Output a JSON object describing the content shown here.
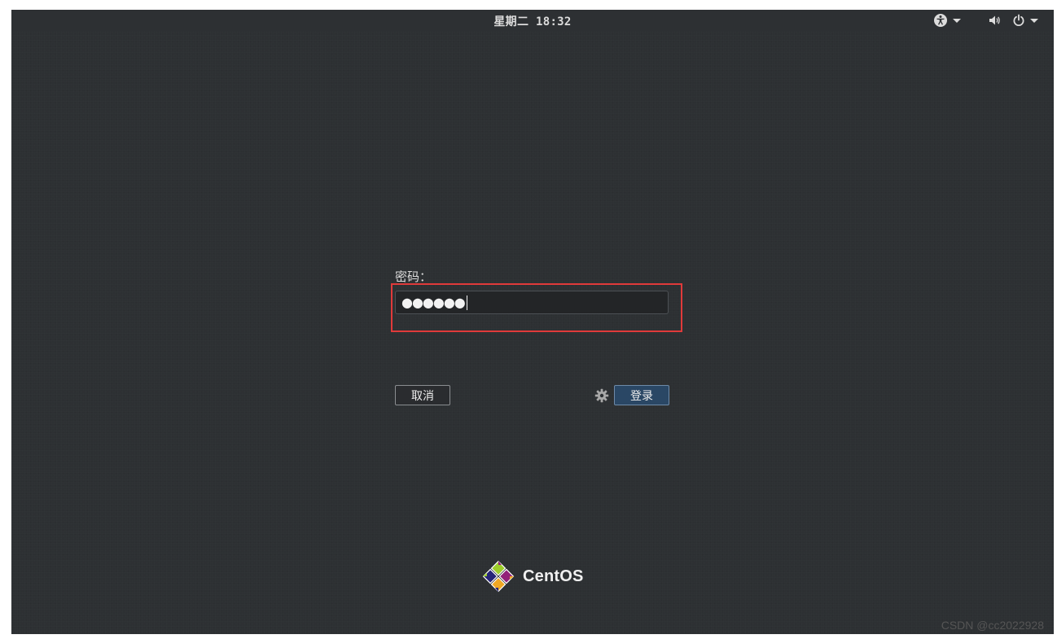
{
  "topbar": {
    "clock": "星期二 18:32",
    "icons": [
      "accessibility-icon",
      "volume-icon",
      "power-icon"
    ]
  },
  "login": {
    "password_label": "密码：",
    "password_value": "●●●●●●",
    "cancel_label": "取消",
    "login_label": "登录",
    "session_icon": "gear-icon"
  },
  "branding": {
    "wordmark": "CentOS"
  },
  "watermark": "CSDN @cc2022928",
  "colors": {
    "background": "#2d3033",
    "highlight": "#e03a3a",
    "login_button": "#2a4765"
  }
}
